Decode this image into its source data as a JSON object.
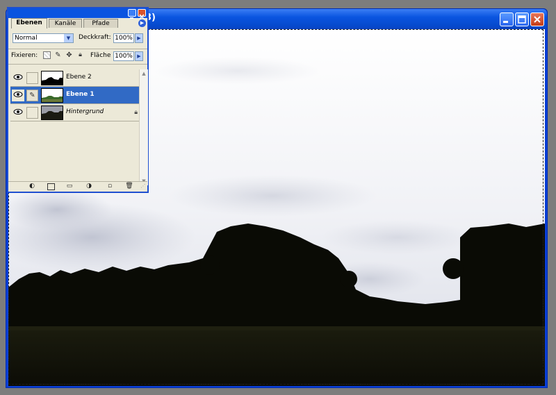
{
  "document": {
    "title_fragment": "3)",
    "colors": {
      "titlebar": "#0a55e0",
      "sky": "#f2f4f8",
      "ground": "#111108"
    }
  },
  "palette": {
    "tabs": [
      {
        "label": "Ebenen",
        "active": true
      },
      {
        "label": "Kanäle",
        "active": false
      },
      {
        "label": "Pfade",
        "active": false
      }
    ],
    "blend_mode": "Normal",
    "opacity_label": "Deckkraft:",
    "opacity_value": "100%",
    "lock_label": "Fixieren:",
    "fill_label": "Fläche",
    "fill_value": "100%",
    "layers": [
      {
        "name": "Ebene 2",
        "visible": true,
        "selected": false,
        "italic": false
      },
      {
        "name": "Ebene 1",
        "visible": true,
        "selected": true,
        "italic": false
      },
      {
        "name": "Hintergrund",
        "visible": true,
        "selected": false,
        "italic": true,
        "locked": true
      }
    ],
    "bottom_icons": [
      "layer-style-icon",
      "layer-mask-icon",
      "new-group-icon",
      "adjustment-layer-icon",
      "new-layer-icon",
      "trash-icon"
    ],
    "accent": "#316ac5"
  }
}
